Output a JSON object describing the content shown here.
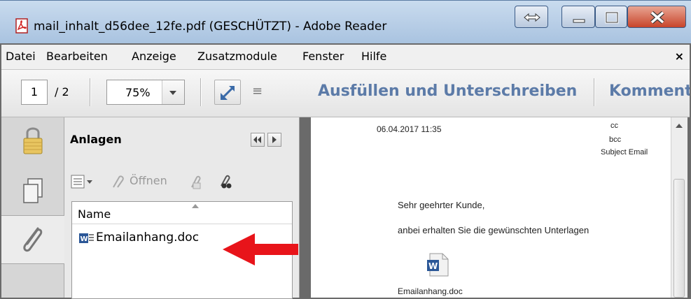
{
  "window": {
    "title": "mail_inhalt_d56dee_12fe.pdf (GESCHÜTZT) - Adobe Reader"
  },
  "menu": {
    "items": [
      "Datei",
      "Bearbeiten",
      "Anzeige",
      "Zusatzmodule",
      "Fenster",
      "Hilfe"
    ],
    "close": "×"
  },
  "toolbar": {
    "page_current": "1",
    "page_total": "/ 2",
    "zoom": "75%",
    "more": "≡",
    "fill_sign": "Ausfüllen und Unterschreiben",
    "comment": "Komment"
  },
  "panel": {
    "title": "Anlagen",
    "open_label": "Öffnen",
    "column_name": "Name",
    "file_name": "Emailanhang.doc"
  },
  "document": {
    "date": "06.04.2017 11:35",
    "cc": "cc",
    "bcc": "bcc",
    "subject": "Subject Email",
    "greeting": "Sehr geehrter Kunde,",
    "body": "anbei erhalten Sie die gewünschten Unterlagen",
    "attachment_label": "Emailanhang.doc"
  },
  "colors": {
    "accent_blue": "#5c7ba8",
    "arrow_red": "#e8141a",
    "close_red": "#c8442a"
  }
}
